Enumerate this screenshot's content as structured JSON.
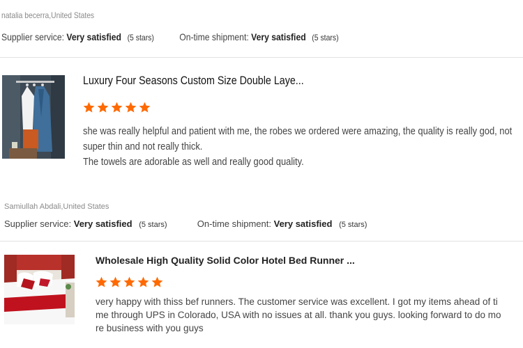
{
  "reviews": [
    {
      "reviewer": "natalia becerra,United States",
      "supplier_label": "Supplier service:",
      "supplier_value": "Very satisfied",
      "supplier_stars": "(5 stars)",
      "shipment_label": "On-time shipment:",
      "shipment_value": "Very satisfied",
      "shipment_stars": "(5 stars)",
      "product_title": "Luxury Four Seasons Custom Size Double Laye...",
      "rating": 5,
      "text_lines": [
        "she was really helpful and patient with me, the robes we ordered were amazing, the quality is really god, not",
        "super thin and not really thick.",
        "The towels are adorable as well and really good quality."
      ],
      "thumb_icon": "bathrobe-product-image"
    },
    {
      "reviewer": "Samiullah Abdali,United States",
      "supplier_label": "Supplier service:",
      "supplier_value": "Very satisfied",
      "supplier_stars": "(5 stars)",
      "shipment_label": "On-time shipment:",
      "shipment_value": "Very satisfied",
      "shipment_stars": "(5 stars)",
      "product_title": "Wholesale High Quality Solid Color Hotel Bed Runner ...",
      "rating": 5,
      "text_lines": [
        "very happy with thiss bef runners. The customer service was excellent. I got my items ahead of ti",
        "me through UPS in Colorado, USA with no issues at all. thank you guys. looking forward to do mo",
        "re business with you guys"
      ],
      "thumb_icon": "bed-runner-product-image"
    }
  ],
  "colors": {
    "star": "#ff6a00",
    "divider": "#e2e2e2"
  }
}
